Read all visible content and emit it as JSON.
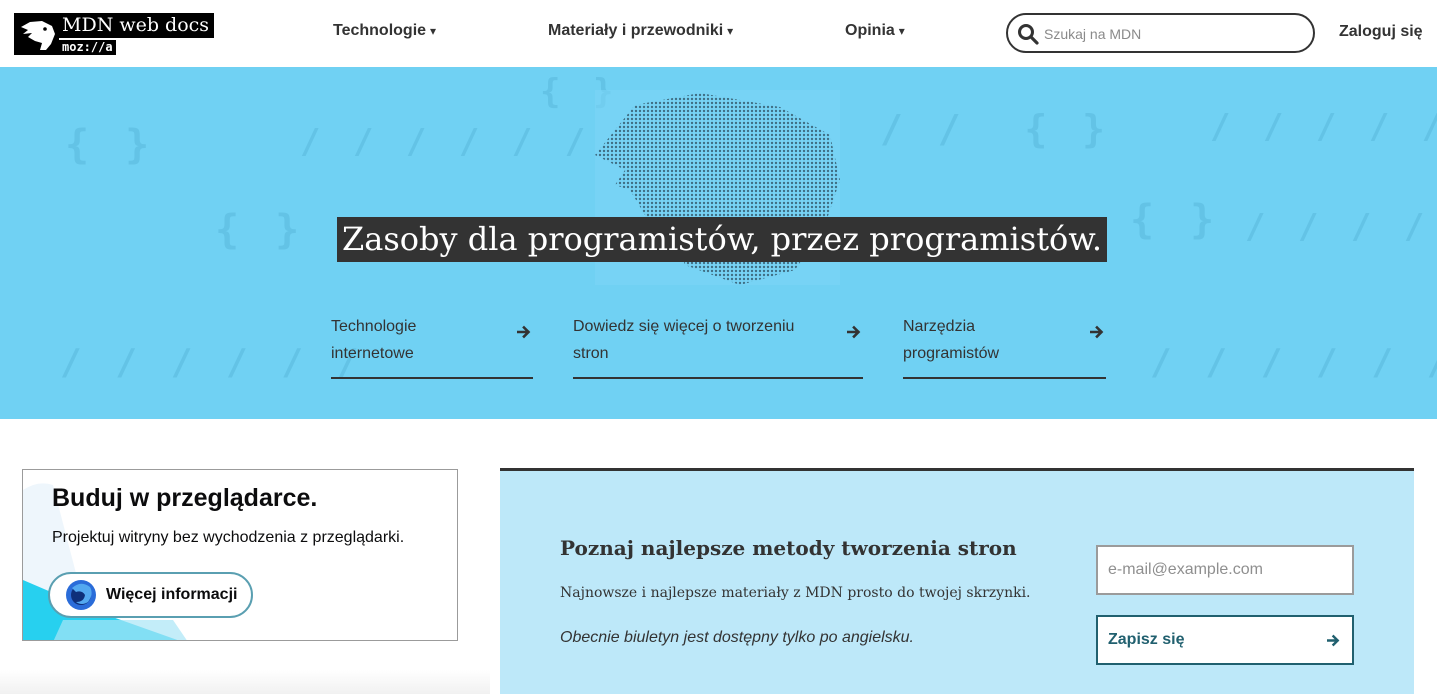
{
  "header": {
    "logo": {
      "title": "MDN web docs",
      "sub": "moz://a"
    },
    "nav": [
      {
        "label": "Technologie",
        "caret": "▾"
      },
      {
        "label": "Materiały i przewodniki",
        "caret": "▾"
      },
      {
        "label": "Opinia",
        "caret": "▾"
      }
    ],
    "search": {
      "placeholder": "Szukaj na MDN",
      "value": "",
      "icon": "search-icon"
    },
    "login_label": "Zaloguj się"
  },
  "hero": {
    "title": "Zasoby dla programistów, przez programistów.",
    "links": [
      {
        "line1": "Technologie",
        "line2": "internetowe",
        "icon": "arrow-right-icon"
      },
      {
        "line1": "Dowiedz się więcej o tworzeniu",
        "line2": "stron",
        "icon": "arrow-right-icon"
      },
      {
        "line1": "Narzędzia",
        "line2": "programistów",
        "icon": "arrow-right-icon"
      }
    ]
  },
  "promo": {
    "title": "Buduj w przeglądarce.",
    "description": "Projektuj witryny bez wychodzenia z przeglądarki.",
    "button_label": "Więcej informacji",
    "button_icon": "firefox-icon"
  },
  "newsletter": {
    "title": "Poznaj najlepsze metody tworzenia stron",
    "description": "Najnowsze i najlepsze materiały z MDN prosto do twojej skrzynki.",
    "note": "Obecnie biuletyn jest dostępny tylko po angielsku.",
    "email_placeholder": "e-mail@example.com",
    "submit_label": "Zapisz się"
  },
  "colors": {
    "hero_bg": "#70d1f3",
    "newsletter_bg": "#bde8f9",
    "text": "#333333",
    "accent": "#21606f"
  }
}
